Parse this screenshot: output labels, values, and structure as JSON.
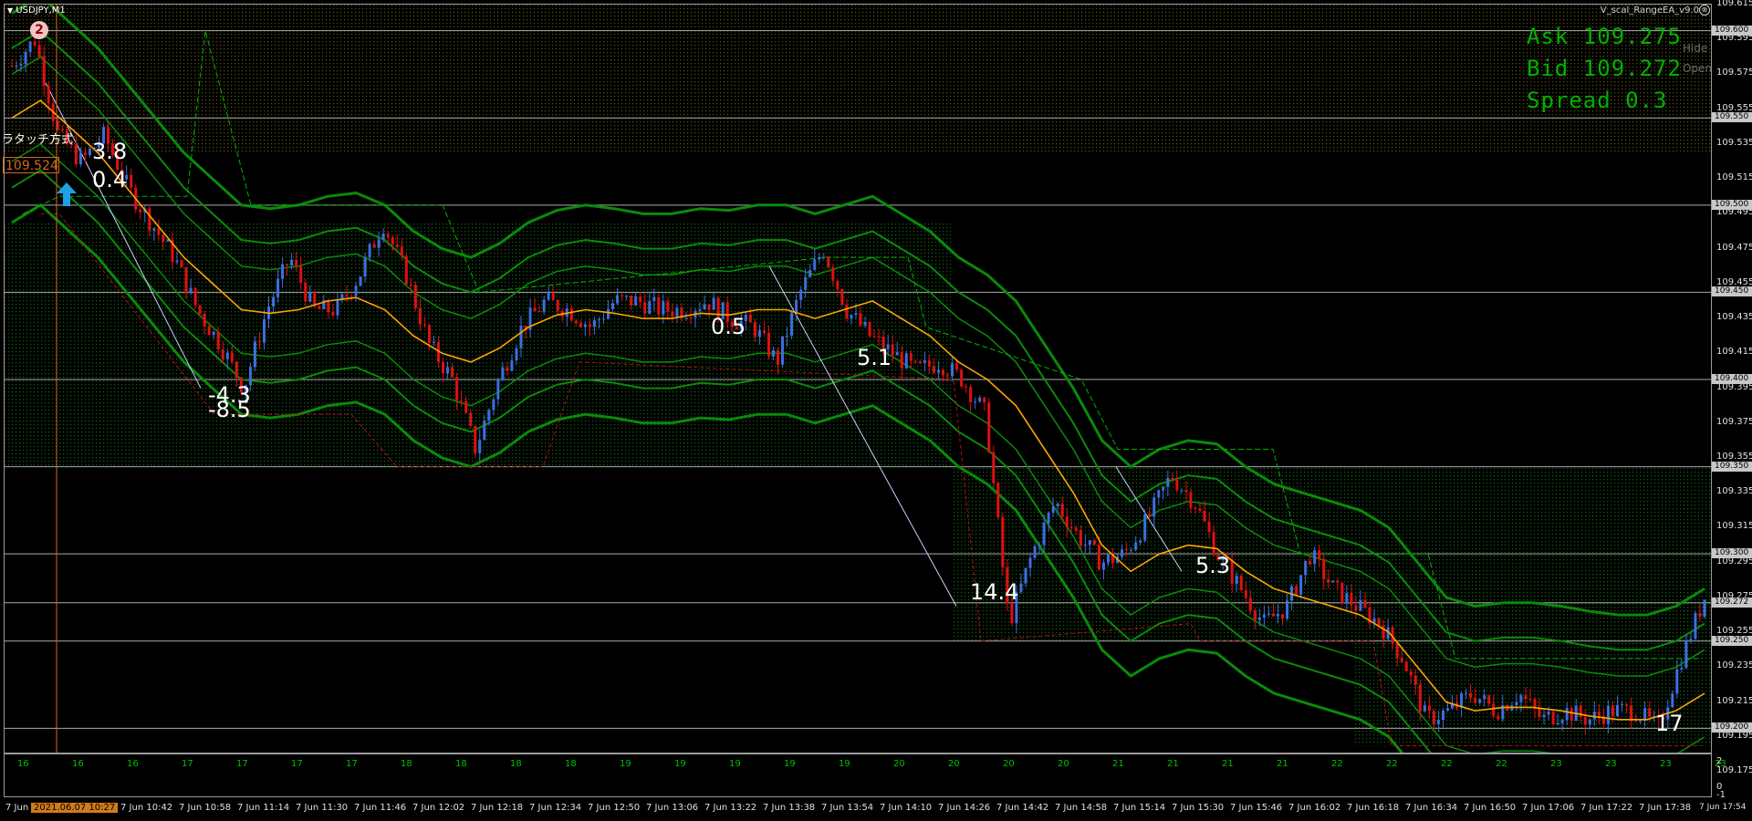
{
  "window": {
    "title": "USDJPY,M1",
    "ea_name": "V_scal_RangeEA_v9.0",
    "close_glyph": "⊗"
  },
  "quote": {
    "ask": "Ask 109.275",
    "bid": "Bid 109.272",
    "spread": "Spread 0.3"
  },
  "side_buttons": {
    "hide": "Hide",
    "open": "Open"
  },
  "colors": {
    "bull": "#3b6fe0",
    "bear": "#e01010",
    "ma": "#ffa500",
    "band": "#0a8a0a",
    "zone_dots": "#0b5a0b",
    "hline": "#c8c8c8",
    "trend": "#d0d0ff",
    "red_step": "#b01010",
    "green_step": "#00b000"
  },
  "price_axis": {
    "min": 109.185,
    "max": 109.615,
    "labels": [
      "109.615",
      "109.595",
      "109.575",
      "109.555",
      "109.535",
      "109.515",
      "109.495",
      "109.475",
      "109.455",
      "109.435",
      "109.415",
      "109.395",
      "109.375",
      "109.355",
      "109.335",
      "109.315",
      "109.295",
      "109.275",
      "109.255",
      "109.235",
      "109.215",
      "109.195",
      "109.175"
    ],
    "badges": [
      "109.600",
      "109.550",
      "109.500",
      "109.450",
      "109.400",
      "109.350",
      "109.300",
      "109.272",
      "109.250",
      "109.200"
    ]
  },
  "hlines": [
    109.6,
    109.55,
    109.5,
    109.45,
    109.4,
    109.35,
    109.3,
    109.272,
    109.25,
    109.2
  ],
  "annotations": {
    "circle": "2",
    "price_tag": "109.524",
    "jp_label": "ラタッチ方式",
    "labels": [
      {
        "text": "3.8",
        "color": "#ffd0d0"
      },
      {
        "text": "0.4",
        "color": "#e01010"
      },
      {
        "text": "-4.3",
        "color": "#e0e0ff"
      },
      {
        "text": "-8.5",
        "color": "#e0e0ff"
      },
      {
        "text": "0.5",
        "color": "#e01010"
      },
      {
        "text": "5.1",
        "color": "#ffd0d0"
      },
      {
        "text": "14.4",
        "color": "#e0e0ff"
      },
      {
        "text": "5.3",
        "color": "#e0e0ff"
      },
      {
        "text": "17",
        "color": "#ffd700"
      }
    ]
  },
  "oscillator": {
    "axis_labels": [
      "2",
      "0",
      "-1"
    ],
    "labels": [
      "16",
      "16",
      "16",
      "17",
      "17",
      "17",
      "17",
      "18",
      "18",
      "18",
      "18",
      "19",
      "19",
      "19",
      "19",
      "19",
      "20",
      "20",
      "20",
      "20",
      "21",
      "21",
      "21",
      "21",
      "22",
      "22",
      "22",
      "22",
      "23",
      "23",
      "23",
      "23"
    ]
  },
  "time_axis": {
    "badge": "2021.06.07 10:27",
    "labels": [
      "7 Jun 2",
      "7 Jun 10:42",
      "7 Jun 10:58",
      "7 Jun 11:14",
      "7 Jun 11:30",
      "7 Jun 11:46",
      "7 Jun 12:02",
      "7 Jun 12:18",
      "7 Jun 12:34",
      "7 Jun 12:50",
      "7 Jun 13:06",
      "7 Jun 13:22",
      "7 Jun 13:38",
      "7 Jun 13:54",
      "7 Jun 14:10",
      "7 Jun 14:26",
      "7 Jun 14:42",
      "7 Jun 14:58",
      "7 Jun 15:14",
      "7 Jun 15:30",
      "7 Jun 15:46",
      "7 Jun 16:02",
      "7 Jun 16:18",
      "7 Jun 16:34",
      "7 Jun 16:50",
      "7 Jun 17:06",
      "7 Jun 17:22",
      "7 Jun 17:38",
      "7 Jun 17:54"
    ]
  },
  "chart_data": {
    "type": "candlestick",
    "title": "USDJPY,M1",
    "ylim": [
      109.185,
      109.615
    ],
    "price_path": [
      109.58,
      109.595,
      109.54,
      109.525,
      109.54,
      109.51,
      109.49,
      109.47,
      109.44,
      109.42,
      109.395,
      109.44,
      109.47,
      109.44,
      109.44,
      109.46,
      109.49,
      109.46,
      109.42,
      109.4,
      109.36,
      109.4,
      109.43,
      109.445,
      109.44,
      109.43,
      109.445,
      109.445,
      109.44,
      109.44,
      109.445,
      109.435,
      109.43,
      109.41,
      109.45,
      109.475,
      109.44,
      109.425,
      109.415,
      109.405,
      109.41,
      109.4,
      109.38,
      109.26,
      109.3,
      109.33,
      109.31,
      109.295,
      109.3,
      109.32,
      109.345,
      109.33,
      109.3,
      109.28,
      109.26,
      109.27,
      109.3,
      109.28,
      109.27,
      109.26,
      109.24,
      109.205,
      109.21,
      109.22,
      109.21,
      109.22,
      109.205,
      109.21,
      109.205,
      109.21,
      109.21,
      109.2,
      109.24,
      109.275
    ],
    "ma_path": [
      109.55,
      109.56,
      109.545,
      109.53,
      109.51,
      109.49,
      109.47,
      109.455,
      109.44,
      109.438,
      109.44,
      109.445,
      109.447,
      109.44,
      109.425,
      109.415,
      109.41,
      109.418,
      109.43,
      109.437,
      109.44,
      109.438,
      109.435,
      109.435,
      109.438,
      109.437,
      109.44,
      109.44,
      109.435,
      109.44,
      109.445,
      109.435,
      109.425,
      109.41,
      109.4,
      109.385,
      109.36,
      109.335,
      109.305,
      109.29,
      109.3,
      109.305,
      109.303,
      109.29,
      109.28,
      109.275,
      109.27,
      109.265,
      109.255,
      109.235,
      109.215,
      109.21,
      109.212,
      109.212,
      109.21,
      109.207,
      109.205,
      109.205,
      109.21,
      109.22
    ]
  }
}
